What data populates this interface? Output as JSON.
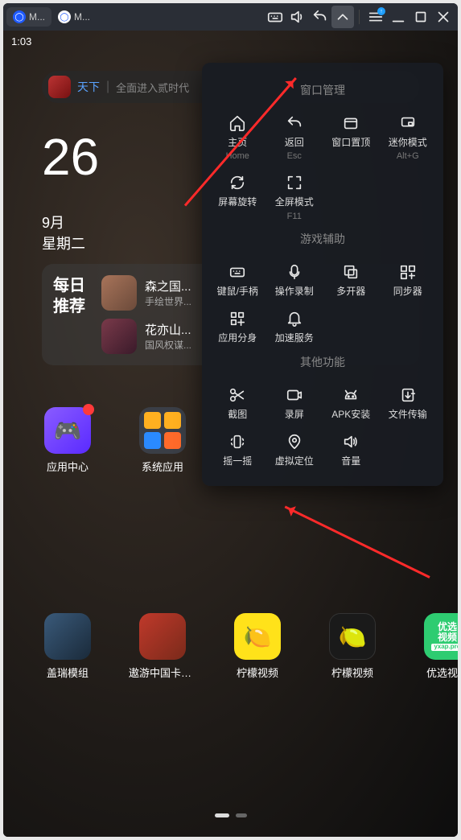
{
  "titlebar": {
    "tab1": "M...",
    "tab2": "M..."
  },
  "status": {
    "time": "1:03"
  },
  "search": {
    "appname": "天下",
    "desc": "全面进入贰时代"
  },
  "date": {
    "day": "26",
    "month": "9月",
    "weekday": "星期二"
  },
  "reco": {
    "title_line1": "每日",
    "title_line2": "推荐",
    "items": [
      {
        "title": "森之国...",
        "sub": "手绘世界..."
      },
      {
        "title": "花亦山...",
        "sub": "国风权谋..."
      }
    ]
  },
  "apps_row1": [
    {
      "label": "应用中心"
    },
    {
      "label": "系统应用"
    }
  ],
  "apps_row2": [
    {
      "label": "盖瑞模组"
    },
    {
      "label": "遨游中国卡车..."
    },
    {
      "label": "柠檬视频"
    },
    {
      "label": "柠檬视频"
    },
    {
      "label": "优选视频"
    }
  ],
  "youxuan": {
    "l1": "优选",
    "l2": "视频",
    "l3": "yxap.pro"
  },
  "popup": {
    "sec1": "窗口管理",
    "sec2": "游戏辅助",
    "sec3": "其他功能",
    "items1": [
      {
        "label": "主页",
        "sub": "Home"
      },
      {
        "label": "返回",
        "sub": "Esc"
      },
      {
        "label": "窗口置顶",
        "sub": ""
      },
      {
        "label": "迷你模式",
        "sub": "Alt+G"
      },
      {
        "label": "屏幕旋转",
        "sub": ""
      },
      {
        "label": "全屏模式",
        "sub": "F11"
      }
    ],
    "items2": [
      {
        "label": "键鼠/手柄"
      },
      {
        "label": "操作录制"
      },
      {
        "label": "多开器"
      },
      {
        "label": "同步器"
      },
      {
        "label": "应用分身"
      },
      {
        "label": "加速服务"
      }
    ],
    "items3": [
      {
        "label": "截图"
      },
      {
        "label": "录屏"
      },
      {
        "label": "APK安装"
      },
      {
        "label": "文件传输"
      },
      {
        "label": "摇一摇"
      },
      {
        "label": "虚拟定位"
      },
      {
        "label": "音量"
      }
    ]
  }
}
